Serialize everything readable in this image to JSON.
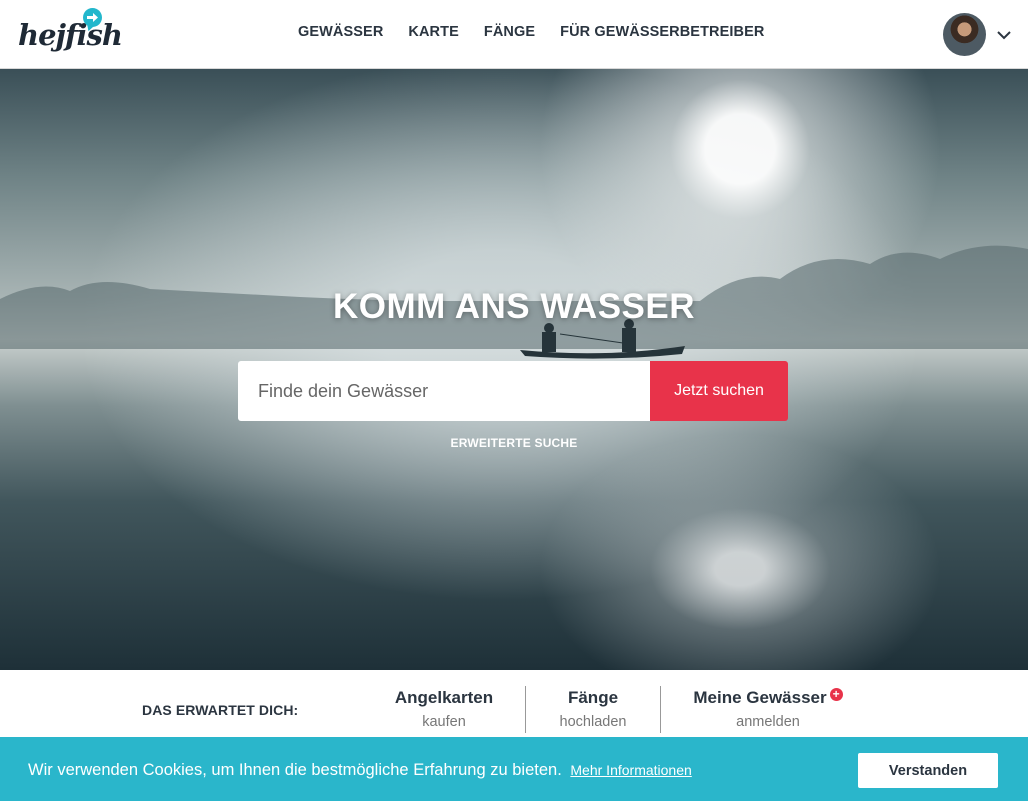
{
  "brand": {
    "logo_text": "hejfish",
    "accent_color": "#23b7cc",
    "cta_color": "#e8334a"
  },
  "nav": {
    "items": [
      {
        "label": "GEWÄSSER"
      },
      {
        "label": "KARTE"
      },
      {
        "label": "FÄNGE"
      },
      {
        "label": "FÜR GEWÄSSERBETREIBER"
      }
    ]
  },
  "user": {
    "avatar_icon": "user-avatar",
    "menu_icon": "chevron-down-icon"
  },
  "hero": {
    "title": "KOMM ANS WASSER",
    "search_placeholder": "Finde dein Gewässer",
    "search_button": "Jetzt suchen",
    "advanced_search": "ERWEITERTE SUCHE"
  },
  "features": {
    "label": "DAS ERWARTET DICH:",
    "items": [
      {
        "title": "Angelkarten",
        "subtitle": "kaufen"
      },
      {
        "title": "Fänge",
        "subtitle": "hochladen"
      },
      {
        "title": "Meine Gewässer",
        "subtitle": "anmelden"
      }
    ]
  },
  "cookie": {
    "text": "Wir verwenden Cookies, um Ihnen die bestmögliche Erfahrung zu bieten.",
    "link": "Mehr Informationen",
    "button": "Verstanden",
    "bar_color": "#2ab6cb"
  }
}
